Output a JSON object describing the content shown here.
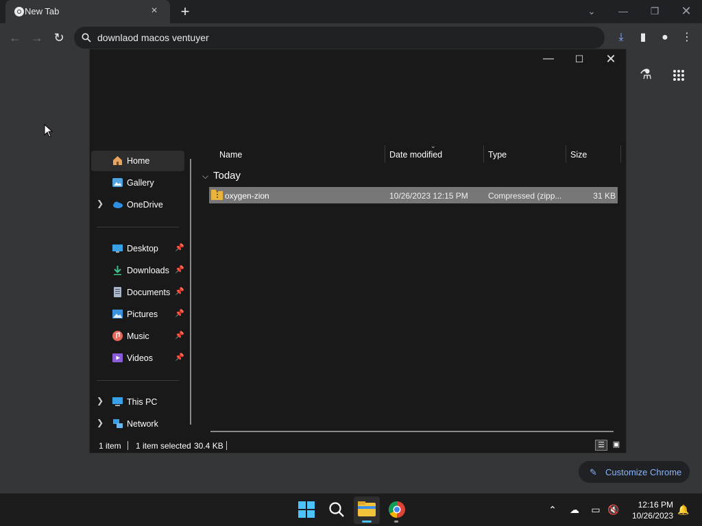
{
  "browser": {
    "tab_title": "New Tab",
    "tab_close_icon": "×",
    "new_tab_icon": "+",
    "omnibox_text": "downlaod macos ventuyer",
    "customize_label": "Customize Chrome"
  },
  "explorer": {
    "nav": {
      "top": [
        {
          "label": "Home",
          "icon": "home-icon"
        },
        {
          "label": "Gallery",
          "icon": "gallery-icon"
        },
        {
          "label": "OneDrive",
          "icon": "onedrive-icon"
        }
      ],
      "quick_access": [
        {
          "label": "Desktop",
          "icon": "desktop-icon"
        },
        {
          "label": "Downloads",
          "icon": "downloads-icon"
        },
        {
          "label": "Documents",
          "icon": "documents-icon"
        },
        {
          "label": "Pictures",
          "icon": "pictures-icon"
        },
        {
          "label": "Music",
          "icon": "music-icon"
        },
        {
          "label": "Videos",
          "icon": "videos-icon"
        }
      ],
      "bottom": [
        {
          "label": "This PC",
          "icon": "this-pc-icon"
        },
        {
          "label": "Network",
          "icon": "network-icon"
        }
      ]
    },
    "columns": {
      "name": "Name",
      "date": "Date modified",
      "type": "Type",
      "size": "Size"
    },
    "group": "Today",
    "file": {
      "name": "oxygen-zion",
      "date": "10/26/2023 12:15 PM",
      "type": "Compressed (zipp...",
      "size": "31 KB"
    },
    "status": {
      "count": "1 item",
      "selected": "1 item selected",
      "size": "30.4 KB"
    }
  },
  "taskbar": {
    "time": "12:16 PM",
    "date": "10/26/2023"
  }
}
